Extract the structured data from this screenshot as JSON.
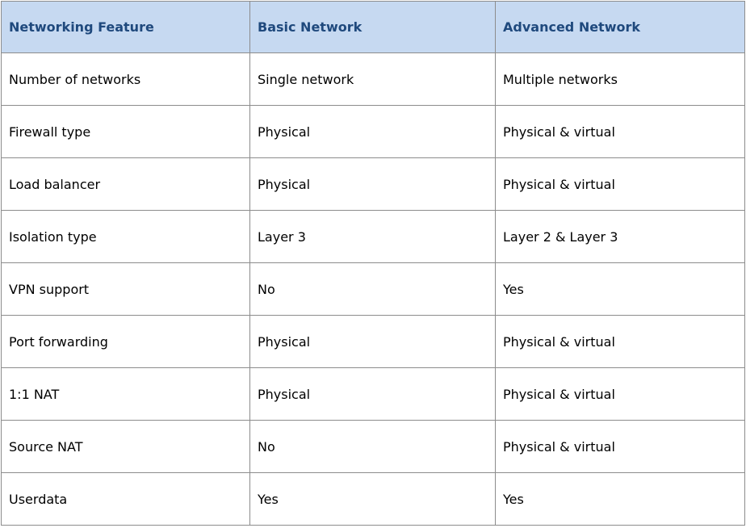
{
  "table": {
    "headers": [
      "Networking Feature",
      "Basic Network",
      "Advanced Network"
    ],
    "rows": [
      [
        "Number of networks",
        "Single network",
        "Multiple networks"
      ],
      [
        "Firewall type",
        "Physical",
        "Physical & virtual"
      ],
      [
        "Load balancer",
        "Physical",
        "Physical & virtual"
      ],
      [
        "Isolation type",
        "Layer 3",
        "Layer 2 & Layer 3"
      ],
      [
        "VPN support",
        "No",
        "Yes"
      ],
      [
        "Port forwarding",
        "Physical",
        "Physical & virtual"
      ],
      [
        "1:1 NAT",
        "Physical",
        "Physical & virtual"
      ],
      [
        "Source NAT",
        "No",
        "Physical & virtual"
      ],
      [
        "Userdata",
        "Yes",
        "Yes"
      ]
    ],
    "header_bg": "#c6d9f1",
    "header_text_color": "#1f497d",
    "border_color": "#8c8c8c"
  }
}
